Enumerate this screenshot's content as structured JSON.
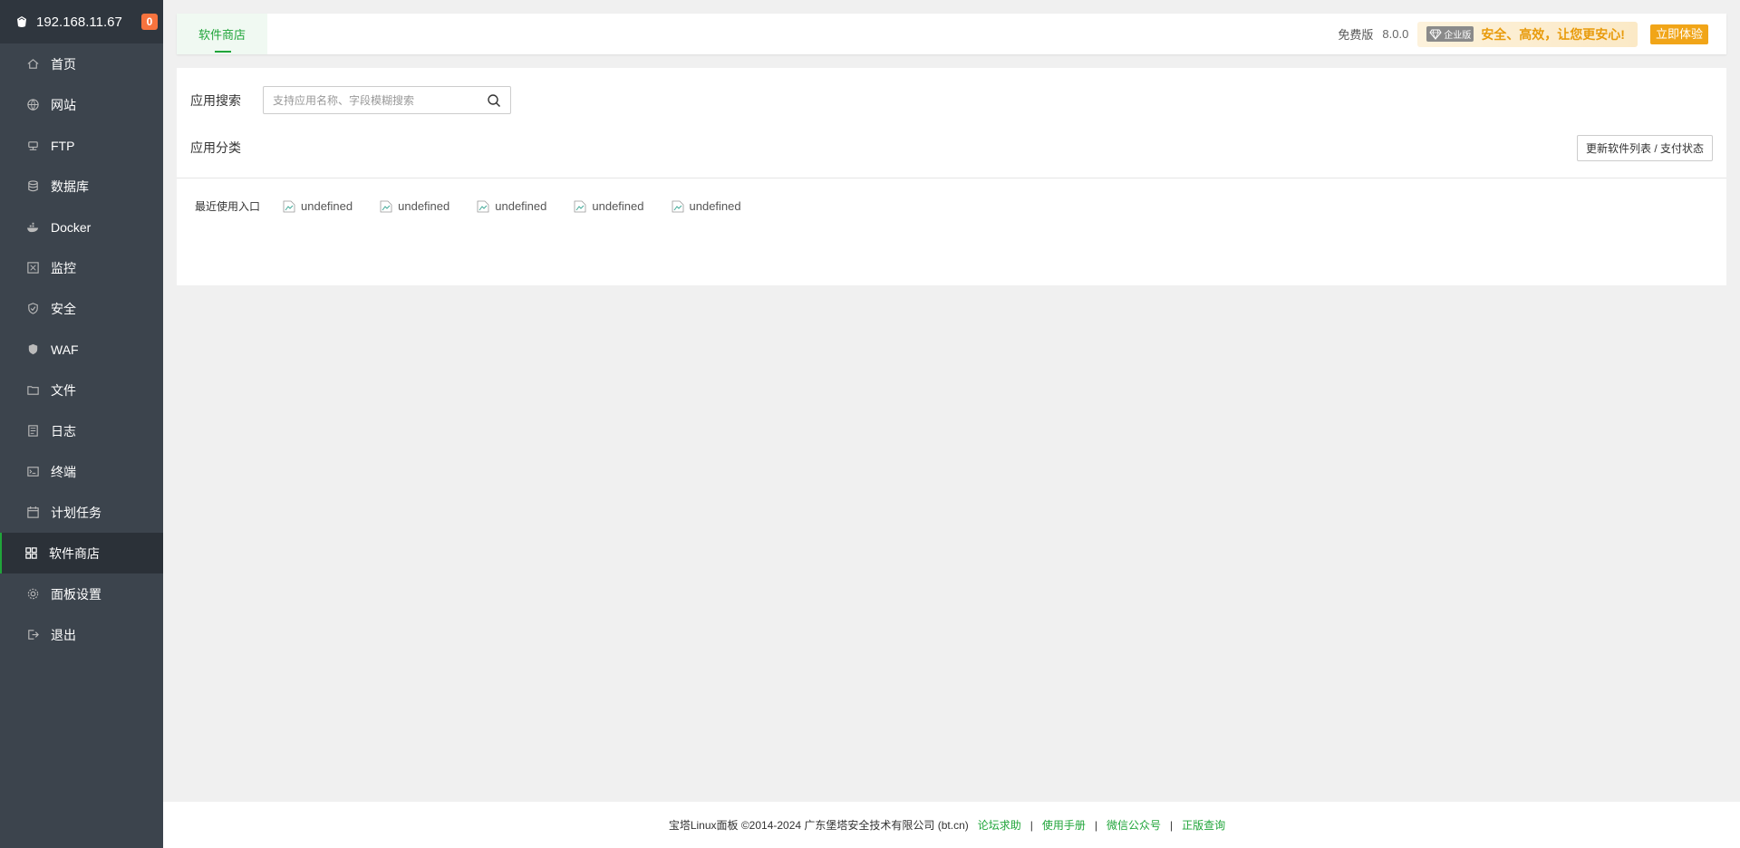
{
  "sidebar": {
    "ip": "192.168.11.67",
    "badge": "0",
    "items": [
      {
        "label": "首页",
        "icon": "home-icon"
      },
      {
        "label": "网站",
        "icon": "globe-icon"
      },
      {
        "label": "FTP",
        "icon": "ftp-icon"
      },
      {
        "label": "数据库",
        "icon": "database-icon"
      },
      {
        "label": "Docker",
        "icon": "docker-icon"
      },
      {
        "label": "监控",
        "icon": "monitor-icon"
      },
      {
        "label": "安全",
        "icon": "shield-icon"
      },
      {
        "label": "WAF",
        "icon": "waf-icon"
      },
      {
        "label": "文件",
        "icon": "folder-icon"
      },
      {
        "label": "日志",
        "icon": "log-icon"
      },
      {
        "label": "终端",
        "icon": "terminal-icon"
      },
      {
        "label": "计划任务",
        "icon": "calendar-icon"
      },
      {
        "label": "软件商店",
        "icon": "grid-icon"
      },
      {
        "label": "面板设置",
        "icon": "gear-icon"
      },
      {
        "label": "退出",
        "icon": "logout-icon"
      }
    ],
    "active_index": 12
  },
  "topbar": {
    "tab": "软件商店",
    "edition": "免费版",
    "version": "8.0.0",
    "enterprise_tag": "企业版",
    "enterprise_text": "安全、高效，让您更安心!",
    "try_button": "立即体验"
  },
  "store": {
    "search_label": "应用搜索",
    "search_placeholder": "支持应用名称、字段模糊搜索",
    "category_label": "应用分类",
    "update_button": "更新软件列表 / 支付状态",
    "recent_label": "最近使用入口",
    "recent_items": [
      "undefined",
      "undefined",
      "undefined",
      "undefined",
      "undefined"
    ]
  },
  "footer": {
    "copyright": "宝塔Linux面板 ©2014-2024 广东堡塔安全技术有限公司 (bt.cn)",
    "links": [
      "论坛求助",
      "使用手册",
      "微信公众号",
      "正版查询"
    ],
    "separator": "|"
  },
  "colors": {
    "accent": "#20a53a",
    "sidebar_bg": "#3c444d",
    "badge": "#f7733e",
    "try_button": "#f1a518"
  }
}
